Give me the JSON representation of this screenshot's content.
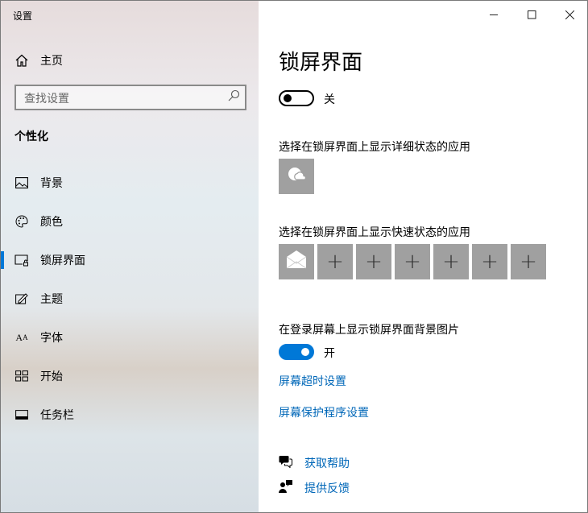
{
  "window": {
    "title": "设置"
  },
  "sidebar": {
    "home": "主页",
    "search_placeholder": "查找设置",
    "section": "个性化",
    "items": [
      {
        "label": "背景",
        "icon": "picture-icon"
      },
      {
        "label": "颜色",
        "icon": "palette-icon"
      },
      {
        "label": "锁屏界面",
        "icon": "lock-screen-icon",
        "selected": true
      },
      {
        "label": "主题",
        "icon": "theme-icon"
      },
      {
        "label": "字体",
        "icon": "font-icon"
      },
      {
        "label": "开始",
        "icon": "start-icon"
      },
      {
        "label": "任务栏",
        "icon": "taskbar-icon"
      }
    ]
  },
  "main": {
    "title": "锁屏界面",
    "toggle1_state": "关",
    "detailed_label": "选择在锁屏界面上显示详细状态的应用",
    "quick_label": "选择在锁屏界面上显示快速状态的应用",
    "plus": "+",
    "signin_label": "在登录屏幕上显示锁屏界面背景图片",
    "toggle2_state": "开",
    "link_timeout": "屏幕超时设置",
    "link_saver": "屏幕保护程序设置",
    "help": "获取帮助",
    "feedback": "提供反馈"
  },
  "colors": {
    "accent": "#0078d7",
    "link": "#0067b8",
    "tile": "#a0a0a0"
  }
}
